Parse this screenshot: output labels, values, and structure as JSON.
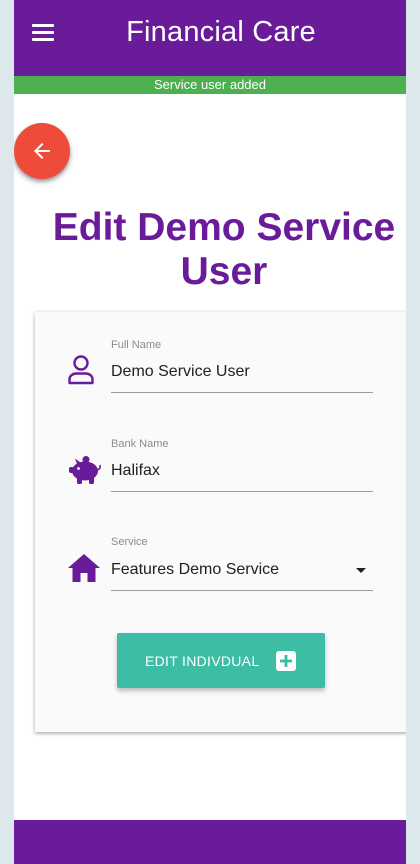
{
  "app": {
    "title": "Financial Care",
    "menu_icon": "hamburger-menu-icon"
  },
  "notification": {
    "text": "Service user added",
    "color": "#4caf50"
  },
  "back_button": {
    "icon": "arrow-left-icon",
    "color": "#ef4b3b"
  },
  "page": {
    "title_line1": "Edit Demo Service",
    "title_line2": "User"
  },
  "form": {
    "full_name": {
      "label": "Full Name",
      "value": "Demo Service User",
      "icon": "person-icon"
    },
    "bank_name": {
      "label": "Bank Name",
      "value": "Halifax",
      "icon": "piggy-bank-icon"
    },
    "service": {
      "label": "Service",
      "value": "Features Demo Service",
      "icon": "home-icon"
    },
    "submit": {
      "label": "EDIT INDIVDUAL",
      "icon": "plus-box-icon",
      "color": "#3cbda4"
    }
  },
  "colors": {
    "brand": "#6a1b9a",
    "background": "#dde8ec"
  }
}
